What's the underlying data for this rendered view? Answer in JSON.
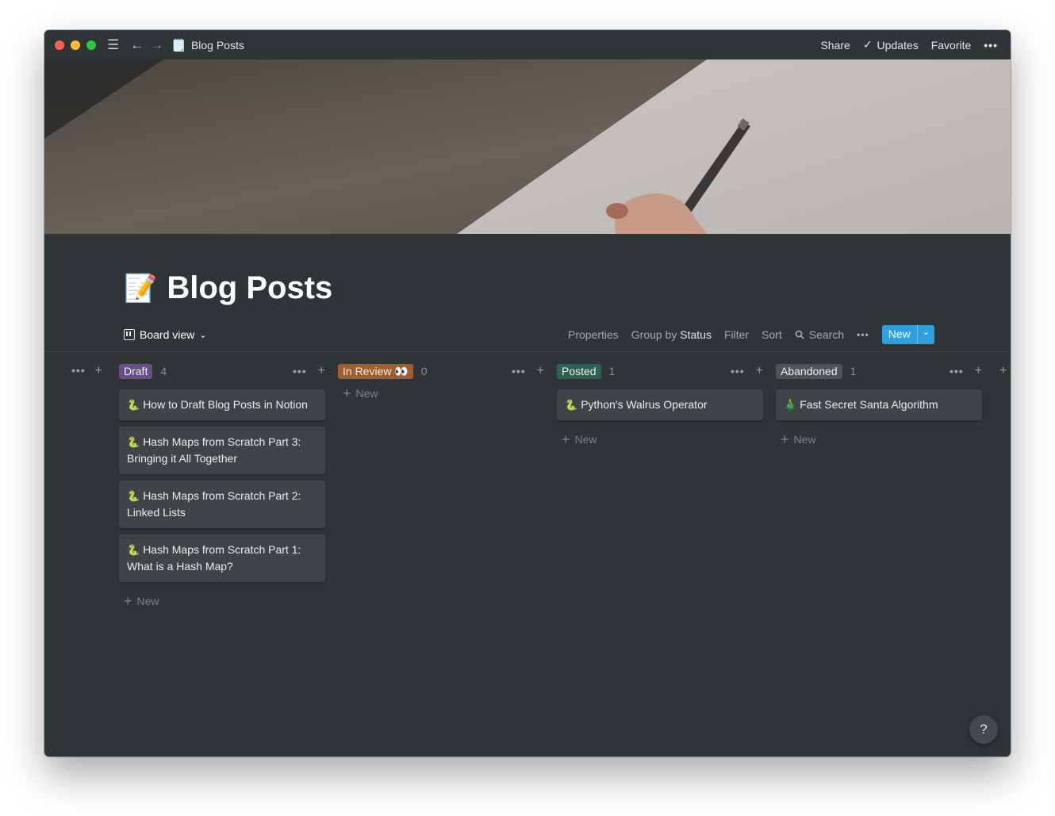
{
  "colors": {
    "background": "#2f3437",
    "accent": "#2ea0e0",
    "draft": "#6a4d8b",
    "in_review": "#a05d2e",
    "posted": "#2c6350",
    "abandoned": "#4f5356"
  },
  "titlebar": {
    "breadcrumb_icon": "🗒️",
    "breadcrumb_title": "Blog Posts",
    "share": "Share",
    "updates": "Updates",
    "favorite": "Favorite",
    "more": "•••"
  },
  "page": {
    "icon": "📝",
    "title": "Blog Posts"
  },
  "viewbar": {
    "view_label": "Board view",
    "properties": "Properties",
    "group_by_prefix": "Group by",
    "group_by_value": "Status",
    "filter": "Filter",
    "sort": "Sort",
    "search": "Search",
    "more": "•••",
    "new": "New"
  },
  "board": {
    "add_new_label": "New",
    "columns": [
      {
        "name": "Draft",
        "count": "4",
        "cards": [
          {
            "icon": "🐍",
            "title": "How to Draft Blog Posts in Notion"
          },
          {
            "icon": "🐍",
            "title": "Hash Maps from Scratch Part 3: Bringing it All Together"
          },
          {
            "icon": "🐍",
            "title": "Hash Maps from Scratch Part 2: Linked Lists"
          },
          {
            "icon": "🐍",
            "title": "Hash Maps from Scratch Part 1: What is a Hash Map?"
          }
        ]
      },
      {
        "name": "In Review 👀",
        "count": "0",
        "cards": []
      },
      {
        "name": "Posted",
        "count": "1",
        "cards": [
          {
            "icon": "🐍",
            "title": "Python's Walrus Operator"
          }
        ]
      },
      {
        "name": "Abandoned",
        "count": "1",
        "cards": [
          {
            "icon": "🎄",
            "title": "Fast Secret Santa Algorithm"
          }
        ]
      }
    ]
  },
  "help": "?"
}
